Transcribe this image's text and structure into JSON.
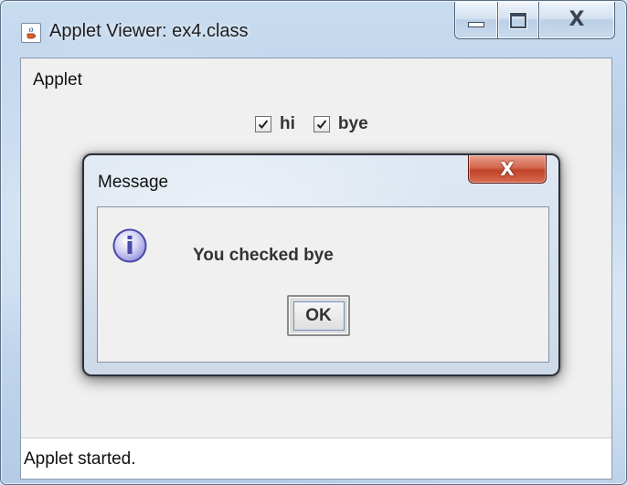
{
  "window": {
    "title": "Applet Viewer: ex4.class",
    "icon": "java-cup-icon",
    "buttons": {
      "minimize": "minimize-icon",
      "maximize": "maximize-icon",
      "close_glyph": "X"
    }
  },
  "applet": {
    "label": "Applet",
    "checkboxes": [
      {
        "label": "hi",
        "checked": true
      },
      {
        "label": "bye",
        "checked": true
      }
    ],
    "status": "Applet started."
  },
  "dialog": {
    "title": "Message",
    "close_glyph": "X",
    "icon": "info-icon",
    "message": "You checked bye",
    "ok_label": "OK"
  },
  "colors": {
    "dialog_close": "#c9472d",
    "info_icon_fill": "#c9c7f2",
    "info_icon_border": "#4a4aa8",
    "ok_focus_border": "#6f8fbf"
  }
}
